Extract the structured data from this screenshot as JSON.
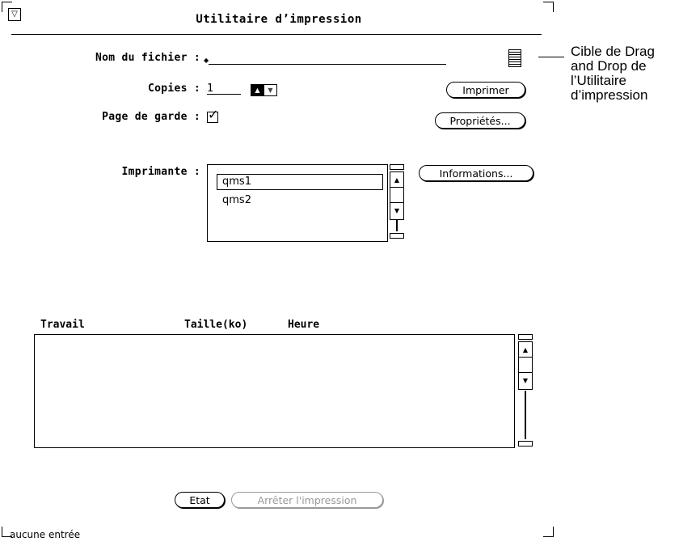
{
  "window": {
    "title": "Utilitaire d’impression",
    "menu_icon": "triangle-down",
    "status": "aucune entrée"
  },
  "form": {
    "filename": {
      "label": "Nom du fichier :",
      "value": ""
    },
    "copies": {
      "label": "Copies :",
      "value": "1"
    },
    "cover_page": {
      "label": "Page de garde :",
      "checked": true
    },
    "printer": {
      "label": "Imprimante :",
      "options": [
        "qms1",
        "qms2"
      ],
      "selected": "qms1"
    }
  },
  "buttons": {
    "print": "Imprimer",
    "properties": "Propriétés...",
    "information": "Informations...",
    "status": "Etat",
    "stop": "Arrêter l'impression"
  },
  "jobs": {
    "columns": [
      "Travail",
      "Taille(ko)",
      "Heure"
    ],
    "rows": []
  },
  "callout": {
    "lines": [
      "Cible de Drag",
      "and Drop de",
      "l’Utilitaire",
      "d’impression"
    ]
  }
}
